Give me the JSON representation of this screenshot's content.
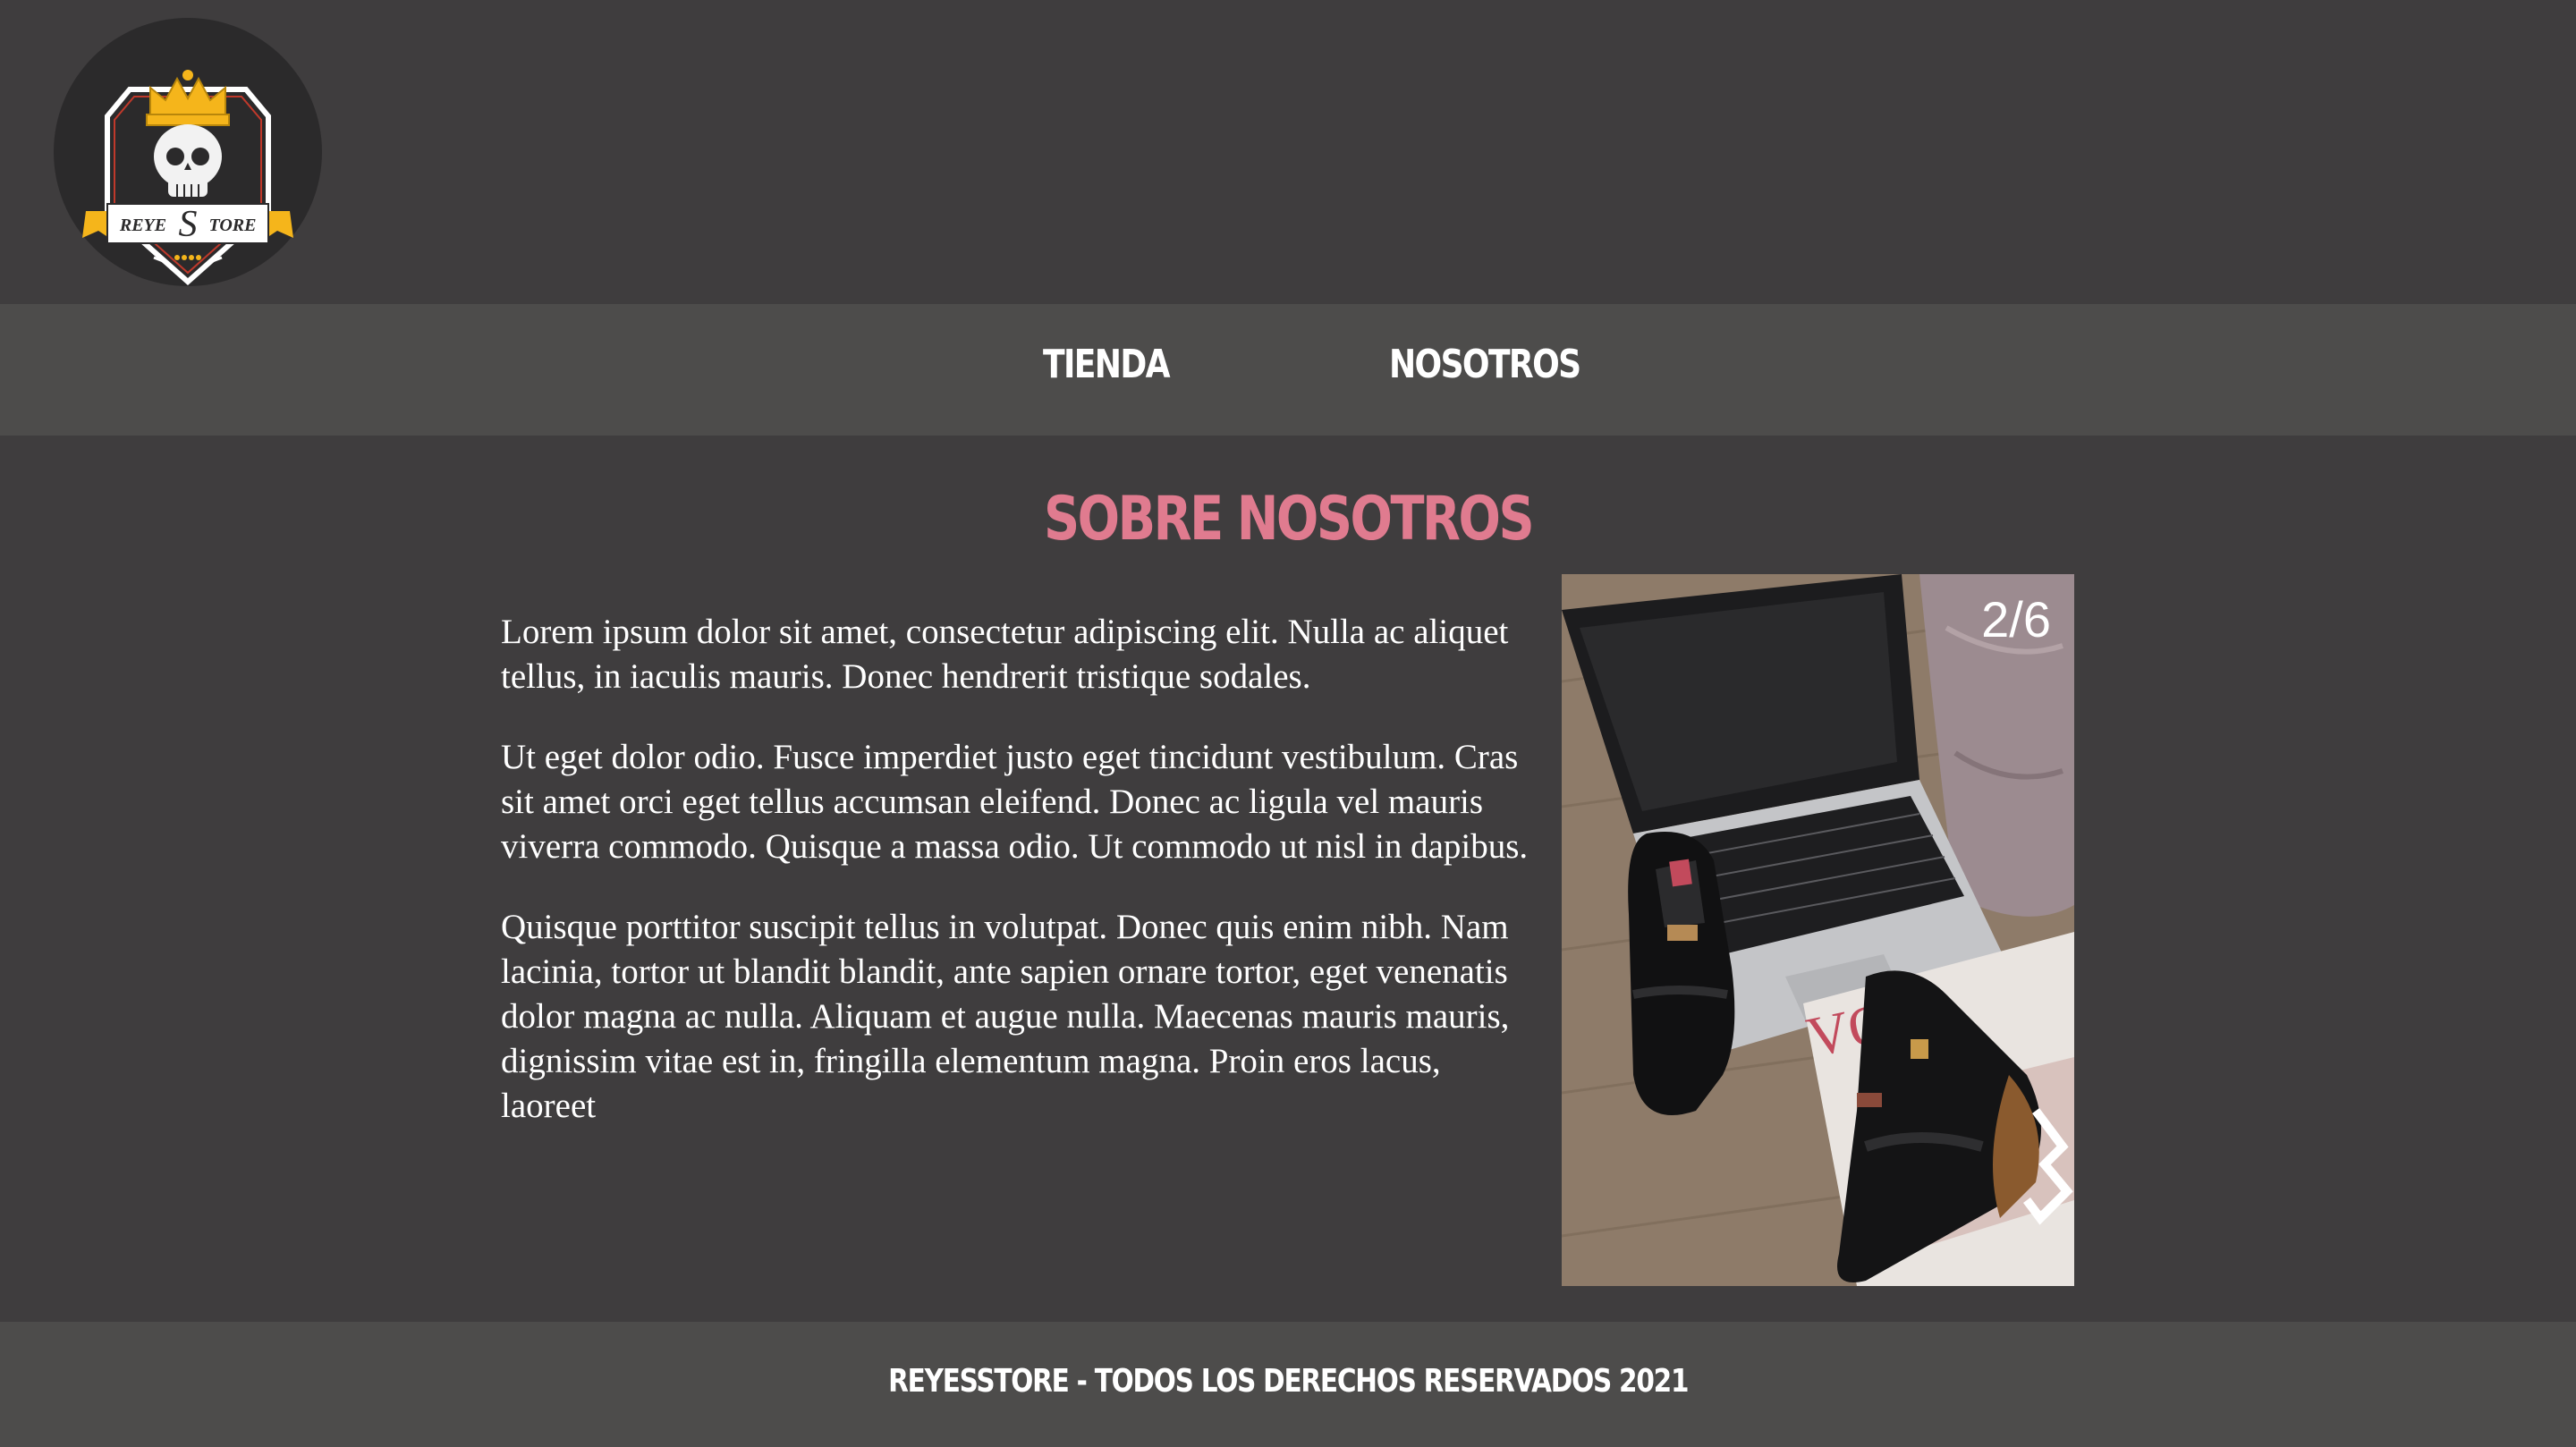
{
  "header": {
    "logo_text_left": "REYE",
    "logo_text_s": "S",
    "logo_text_right": "TORE",
    "logo_icon": "skull-crown-logo-icon"
  },
  "nav": {
    "items": [
      {
        "label": "TIENDA"
      },
      {
        "label": "NOSOTROS"
      }
    ]
  },
  "main": {
    "title": "SOBRE NOSOTROS",
    "paragraphs": [
      "Lorem ipsum dolor sit amet, consectetur adipiscing elit. Nulla ac aliquet tellus, in iaculis mauris. Donec hendrerit tristique sodales.",
      "Ut eget dolor odio. Fusce imperdiet justo eget tincidunt vestibulum. Cras sit amet orci eget tellus accumsan eleifend. Donec ac ligula vel mauris viverra commodo. Quisque a massa odio. Ut commodo ut nisl in dapibus.",
      "Quisque porttitor suscipit tellus in volutpat. Donec quis enim nibh. Nam lacinia, tortor ut blandit blandit, ante sapien ornare tortor, eget venenatis dolor magna ac nulla. Aliquam et augue nulla. Maecenas mauris mauris, dignissim vitae est in, fringilla elementum magna. Proin eros lacus, laoreet"
    ],
    "carousel": {
      "counter": "2/6",
      "current": 2,
      "total": 6,
      "magazine_text": "VOG"
    }
  },
  "footer": {
    "text": "REYESSTORE - TODOS LOS DERECHOS RESERVADOS 2021"
  },
  "colors": {
    "background": "#3f3d3e",
    "bar": "#4d4c4b",
    "accent_pink": "#e07b8f",
    "text": "#ffffff",
    "logo_gold": "#f5b51b"
  }
}
